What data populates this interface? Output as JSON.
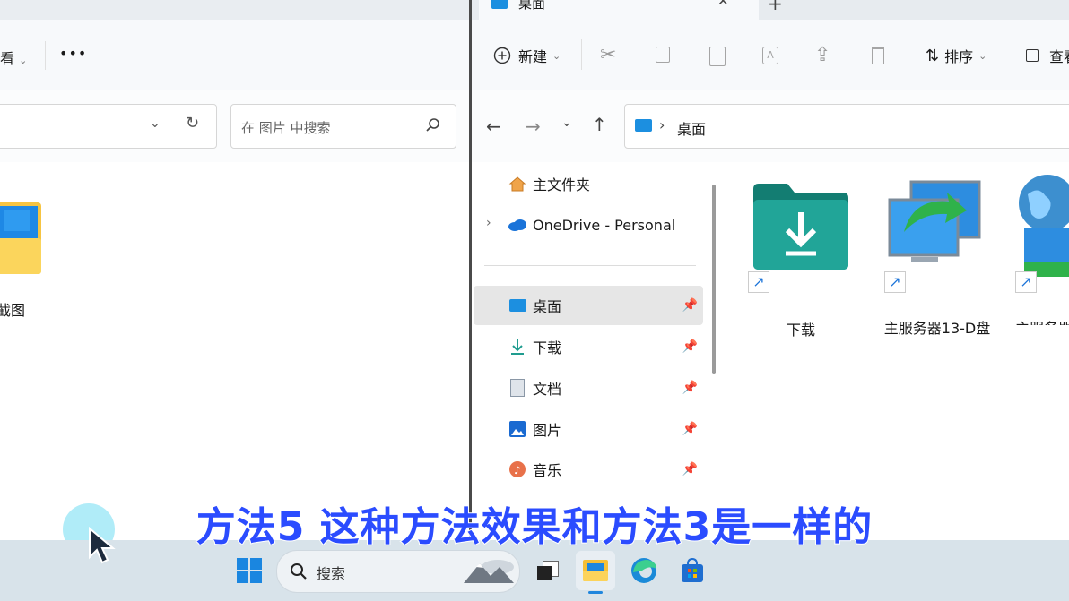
{
  "left_window": {
    "view_label": "看",
    "more_label": "•••",
    "search_placeholder": "在 图片 中搜索",
    "file_label": "截图"
  },
  "right_window": {
    "tab_title": "桌面",
    "tab_close": "✕",
    "tab_new": "+",
    "toolbar": {
      "new_label": "新建",
      "sort_label": "排序",
      "view_label": "查看"
    },
    "breadcrumb": {
      "sep": "›",
      "current": "桌面"
    },
    "nav": {
      "home": "主文件夹",
      "onedrive": "OneDrive - Personal",
      "items": [
        {
          "label": "桌面",
          "icon": "desktop-icon"
        },
        {
          "label": "下载",
          "icon": "download-icon"
        },
        {
          "label": "文档",
          "icon": "document-icon"
        },
        {
          "label": "图片",
          "icon": "pictures-icon"
        },
        {
          "label": "音乐",
          "icon": "music-icon"
        }
      ]
    },
    "files": [
      {
        "label": "下载",
        "icon": "download-folder-icon"
      },
      {
        "label": "主服务器13-D盘",
        "icon": "network-drive-icon"
      },
      {
        "label": "主服务器",
        "icon": "globe-drive-icon"
      }
    ]
  },
  "taskbar": {
    "search_label": "搜索"
  },
  "caption": "方法5 这种方法效果和方法3是一样的",
  "colors": {
    "caption": "#2b4cff",
    "selection": "#e6e6e6",
    "folder_teal": "#1f9c8f",
    "accent": "#0078d4"
  }
}
